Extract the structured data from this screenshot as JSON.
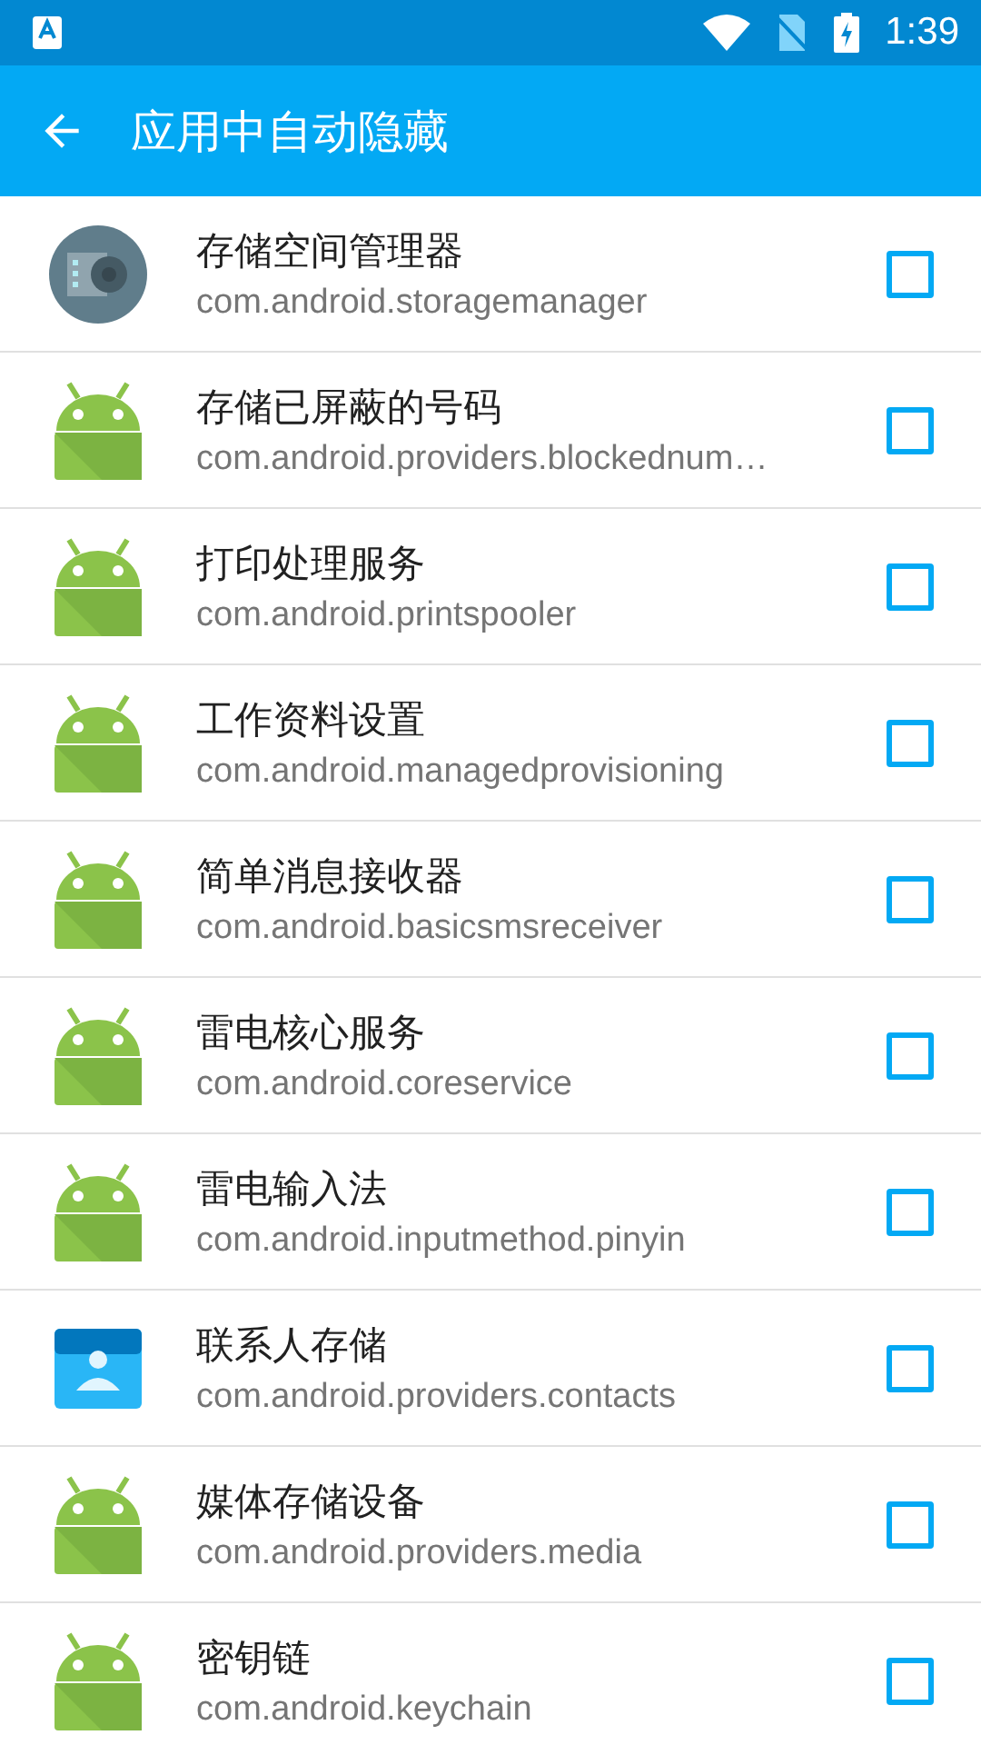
{
  "status_bar": {
    "time": "1:39"
  },
  "app_bar": {
    "title": "应用中自动隐藏"
  },
  "apps": [
    {
      "name": "存储空间管理器",
      "package": "com.android.storagemanager",
      "kind": "storage",
      "checked": false
    },
    {
      "name": "存储已屏蔽的号码",
      "package": "com.android.providers.blockednum…",
      "kind": "android",
      "checked": false
    },
    {
      "name": "打印处理服务",
      "package": "com.android.printspooler",
      "kind": "android",
      "checked": false
    },
    {
      "name": "工作资料设置",
      "package": "com.android.managedprovisioning",
      "kind": "android",
      "checked": false
    },
    {
      "name": "简单消息接收器",
      "package": "com.android.basicsmsreceiver",
      "kind": "android",
      "checked": false
    },
    {
      "name": "雷电核心服务",
      "package": "com.android.coreservice",
      "kind": "android",
      "checked": false
    },
    {
      "name": "雷电输入法",
      "package": "com.android.inputmethod.pinyin",
      "kind": "android",
      "checked": false
    },
    {
      "name": "联系人存储",
      "package": "com.android.providers.contacts",
      "kind": "contacts",
      "checked": false
    },
    {
      "name": "媒体存储设备",
      "package": "com.android.providers.media",
      "kind": "android",
      "checked": false
    },
    {
      "name": "密钥链",
      "package": "com.android.keychain",
      "kind": "android",
      "checked": false
    }
  ]
}
